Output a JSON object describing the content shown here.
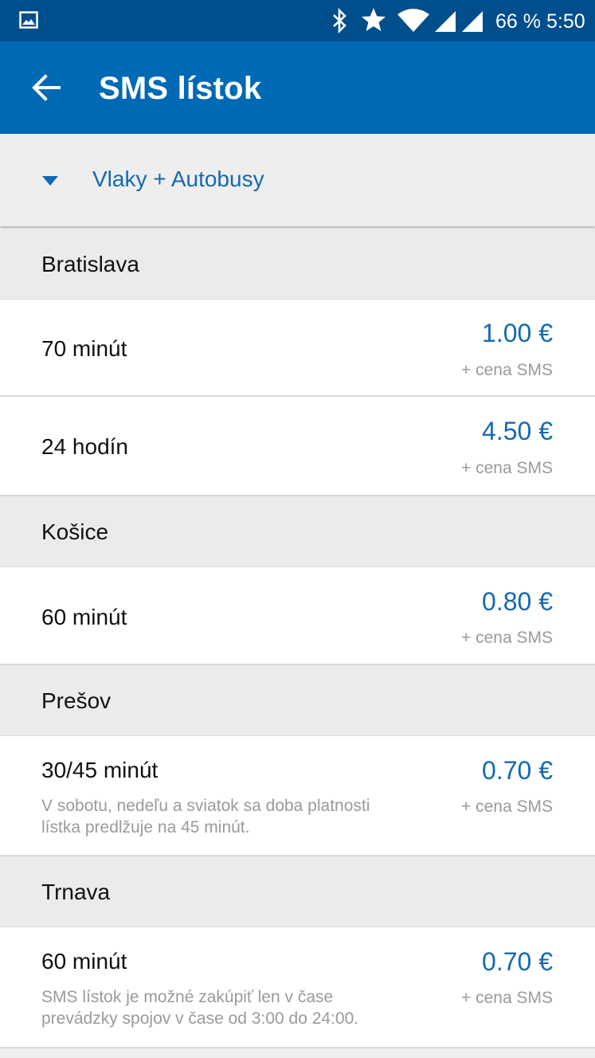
{
  "status_bar": {
    "battery": "66 %",
    "time": "5:50",
    "icons": [
      "image-icon",
      "bluetooth-icon",
      "star-icon",
      "wifi-icon",
      "signal-icon",
      "signal-icon"
    ]
  },
  "app_bar": {
    "back_icon": "arrow-back-icon",
    "title": "SMS lístok"
  },
  "filter": {
    "icon": "caret-down-icon",
    "selected": "Vlaky + Autobusy"
  },
  "sections": [
    {
      "name": "Bratislava",
      "tickets": [
        {
          "title": "70 minút",
          "note": "",
          "price": "1.00 €",
          "price_note": "+ cena SMS"
        },
        {
          "title": "24 hodín",
          "note": "",
          "price": "4.50 €",
          "price_note": "+ cena SMS"
        }
      ]
    },
    {
      "name": "Košice",
      "tickets": [
        {
          "title": "60 minút",
          "note": "",
          "price": "0.80 €",
          "price_note": "+ cena SMS"
        }
      ]
    },
    {
      "name": "Prešov",
      "tickets": [
        {
          "title": "30/45 minút",
          "note": "V sobotu, nedeľu a sviatok sa doba platnosti lístka predlžuje na 45 minút.",
          "price": "0.70 €",
          "price_note": "+ cena SMS"
        }
      ]
    },
    {
      "name": "Trnava",
      "tickets": [
        {
          "title": "60 minút",
          "note": "SMS lístok je možné zakúpiť len v čase prevádzky spojov v čase od 3:00 do 24:00.",
          "price": "0.70 €",
          "price_note": "+ cena SMS"
        }
      ]
    }
  ],
  "colors": {
    "status_bar": "#004e8c",
    "app_bar": "#0069b4",
    "accent": "#1569b0"
  }
}
